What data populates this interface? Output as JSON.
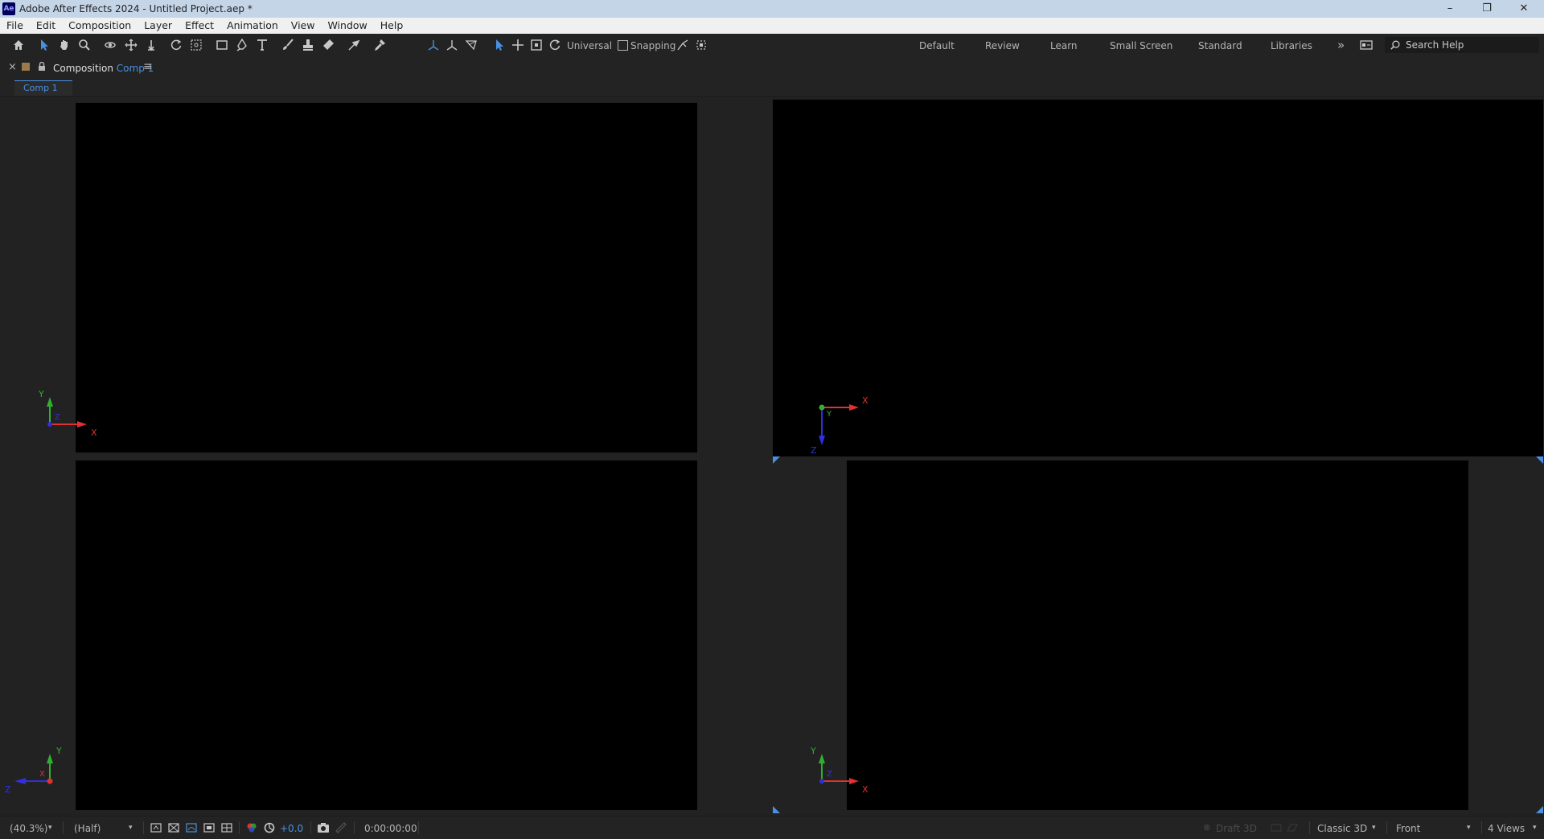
{
  "window": {
    "title": "Adobe After Effects 2024 - Untitled Project.aep *",
    "logo_text": "Ae",
    "minimize": "–",
    "maximize": "❐",
    "close": "✕"
  },
  "menu": [
    "File",
    "Edit",
    "Composition",
    "Layer",
    "Effect",
    "Animation",
    "View",
    "Window",
    "Help"
  ],
  "toolbar": {
    "universal_label": "Universal",
    "snapping_label": "Snapping",
    "workspaces": [
      "Default",
      "Review",
      "Learn",
      "Small Screen",
      "Standard",
      "Libraries"
    ],
    "overflow": "»",
    "search_placeholder": "Search Help"
  },
  "panel": {
    "close": "×",
    "tab_prefix": "Composition",
    "tab_comp": "Comp 1",
    "menu_icon": "≡",
    "comp_tab": "Comp 1"
  },
  "axes": {
    "x": "X",
    "y": "Y",
    "z": "Z"
  },
  "bottombar": {
    "zoom": "(40.3%)",
    "resolution": "(Half)",
    "exposure": "+0.0",
    "timecode": "0:00:00:00",
    "draft3d": "Draft 3D",
    "renderer": "Classic 3D",
    "view": "Front",
    "layout": "4 Views"
  },
  "colors": {
    "accent": "#4a90e2",
    "axis_x": "#e03030",
    "axis_y": "#30b030",
    "axis_z": "#3030e0"
  }
}
